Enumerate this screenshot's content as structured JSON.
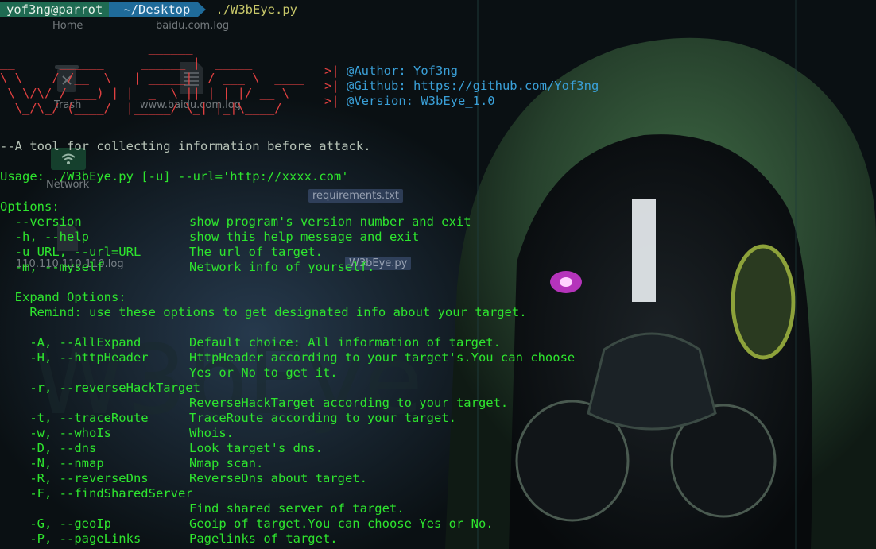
{
  "prompt": {
    "user_host": "yof3ng@parrot",
    "directory": "~/Desktop",
    "command": "./W3bEye.py"
  },
  "desktop_icons": {
    "home": "Home",
    "baidu_log": "baidu.com.log",
    "trash": "Trash",
    "www_baidu_log": "www.baidu.com.log",
    "network": "Network",
    "requirements": "requirements.txt",
    "ip_log": "110.110.110.110.log",
    "script": "W3bEye.py"
  },
  "banner": {
    "art": [
      "                    ______",
      "__      ______     ______ |  _____",
      "\\ \\    / /__  \\   | _____|  / ___ \\  ____",
      " \\ \\/\\/ / ___) | |  _  \\ || | | |/ __ \\",
      "  \\_/\\_/ (____/  |_____/ \\_| |_|\\____/"
    ],
    "author": "@Author: Yof3ng",
    "github": "@Github: https://github.com/Yof3ng",
    "version": "@Version: W3bEye_1.0"
  },
  "description": "--A tool for collecting information before attack.",
  "usage": "Usage: ./W3bEye.py [-u] --url='http://xxxx.com'",
  "options": {
    "heading": "Options:",
    "items": [
      {
        "flag": "  --version",
        "desc": "show program's version number and exit"
      },
      {
        "flag": "  -h, --help",
        "desc": "show this help message and exit"
      },
      {
        "flag": "  -u URL, --url=URL",
        "desc": "The url of target."
      },
      {
        "flag": "  -m, --myself",
        "desc": "Network info of yourself."
      }
    ]
  },
  "expand": {
    "heading": "  Expand Options:",
    "remind": "    Remind: use these options to get designated info about your target.",
    "items": [
      {
        "flag": "    -A, --AllExpand",
        "desc": "Default choice: All information of target."
      },
      {
        "flag": "    -H, --httpHeader",
        "desc": "HttpHeader according to your target's.You can choose"
      },
      {
        "flag": "",
        "desc": "Yes or No to get it."
      },
      {
        "flag": "    -r, --reverseHackTarget",
        "desc": ""
      },
      {
        "flag": "",
        "desc": "ReverseHackTarget according to your target."
      },
      {
        "flag": "    -t, --traceRoute",
        "desc": "TraceRoute according to your target."
      },
      {
        "flag": "    -w, --whoIs",
        "desc": "Whois."
      },
      {
        "flag": "    -D, --dns",
        "desc": "Look target's dns."
      },
      {
        "flag": "    -N, --nmap",
        "desc": "Nmap scan."
      },
      {
        "flag": "    -R, --reverseDns",
        "desc": "ReverseDns about target."
      },
      {
        "flag": "    -F, --findSharedServer",
        "desc": ""
      },
      {
        "flag": "",
        "desc": "Find shared server of target."
      },
      {
        "flag": "    -G, --geoIp",
        "desc": "Geoip of target.You can choose Yes or No."
      },
      {
        "flag": "    -P, --pageLinks",
        "desc": "Pagelinks of target."
      }
    ]
  },
  "colors": {
    "terminal_text": "#29d829",
    "banner_art": "#e04040",
    "banner_info": "#3aa0d8",
    "prompt_user_bg": "#1f6b52",
    "prompt_dir_bg": "#1f6b9a"
  }
}
